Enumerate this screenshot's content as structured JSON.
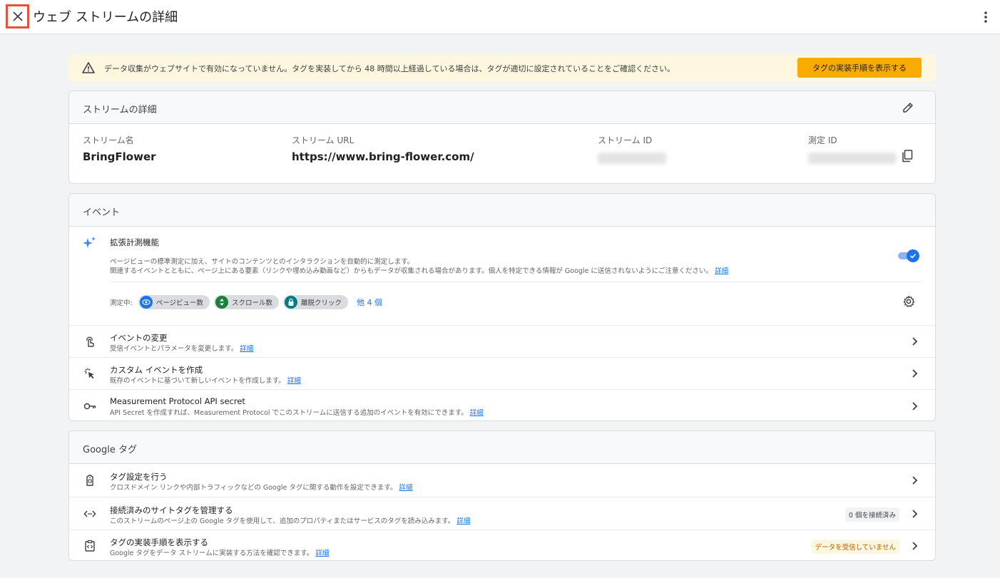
{
  "header": {
    "title": "ウェブ ストリームの詳細"
  },
  "banner": {
    "message": "データ収集がウェブサイトで有効になっていません。タグを実装してから 48 時間以上経過している場合は、タグが適切に設定されていることをご確認ください。",
    "button_label": "タグの実装手順を表示する"
  },
  "stream_details": {
    "title": "ストリームの詳細",
    "name_label": "ストリーム名",
    "name_value": "BringFlower",
    "url_label": "ストリーム URL",
    "url_value": "https://www.bring-flower.com/",
    "id_label": "ストリーム ID",
    "measurement_id_label": "測定 ID"
  },
  "events": {
    "title": "イベント",
    "enhanced": {
      "title": "拡張計測機能",
      "desc_line1": "ページビューの標準測定に加え、サイトのコンテンツとのインタラクションを自動的に測定します。",
      "desc_line2": "関連するイベントとともに、ページ上にある要素（リンクや埋め込み動画など）からもデータが収集される場合があります。個人を特定できる情報が Google に送信されないようにご注意ください。",
      "link": "詳細",
      "measuring_label": "測定中:",
      "chips": [
        "ページビュー数",
        "スクロール数",
        "離脱クリック"
      ],
      "more": "他 4 個",
      "enabled": true
    },
    "rows": [
      {
        "title": "イベントの変更",
        "desc": "受信イベントとパラメータを変更します。",
        "link": "詳細"
      },
      {
        "title": "カスタム イベントを作成",
        "desc": "既存のイベントに基づいて新しいイベントを作成します。",
        "link": "詳細"
      },
      {
        "title": "Measurement Protocol API secret",
        "desc": "API Secret を作成すれば、Measurement Protocol でこのストリームに送信する追加のイベントを有効にできます。",
        "link": "詳細"
      }
    ]
  },
  "google_tag": {
    "title": "Google タグ",
    "rows": [
      {
        "title": "タグ設定を行う",
        "desc": "クロスドメイン リンクや内部トラフィックなどの Google タグに関する動作を設定できます。",
        "link": "詳細"
      },
      {
        "title": "接続済みのサイトタグを管理する",
        "desc": "このストリームのページ上の Google タグを使用して、追加のプロパティまたはサービスのタグを読み込みます。",
        "link": "詳細",
        "badge": "0 個を接続済み"
      },
      {
        "title": "タグの実装手順を表示する",
        "desc": "Google タグをデータ ストリームに実装する方法を確認できます。",
        "link": "詳細",
        "badge": "データを受信していません"
      }
    ]
  },
  "colors": {
    "accent": "#1a73e8",
    "warning_button": "#f9ab00",
    "banner_bg": "#fef7e0",
    "close_highlight": "#e0533d"
  }
}
